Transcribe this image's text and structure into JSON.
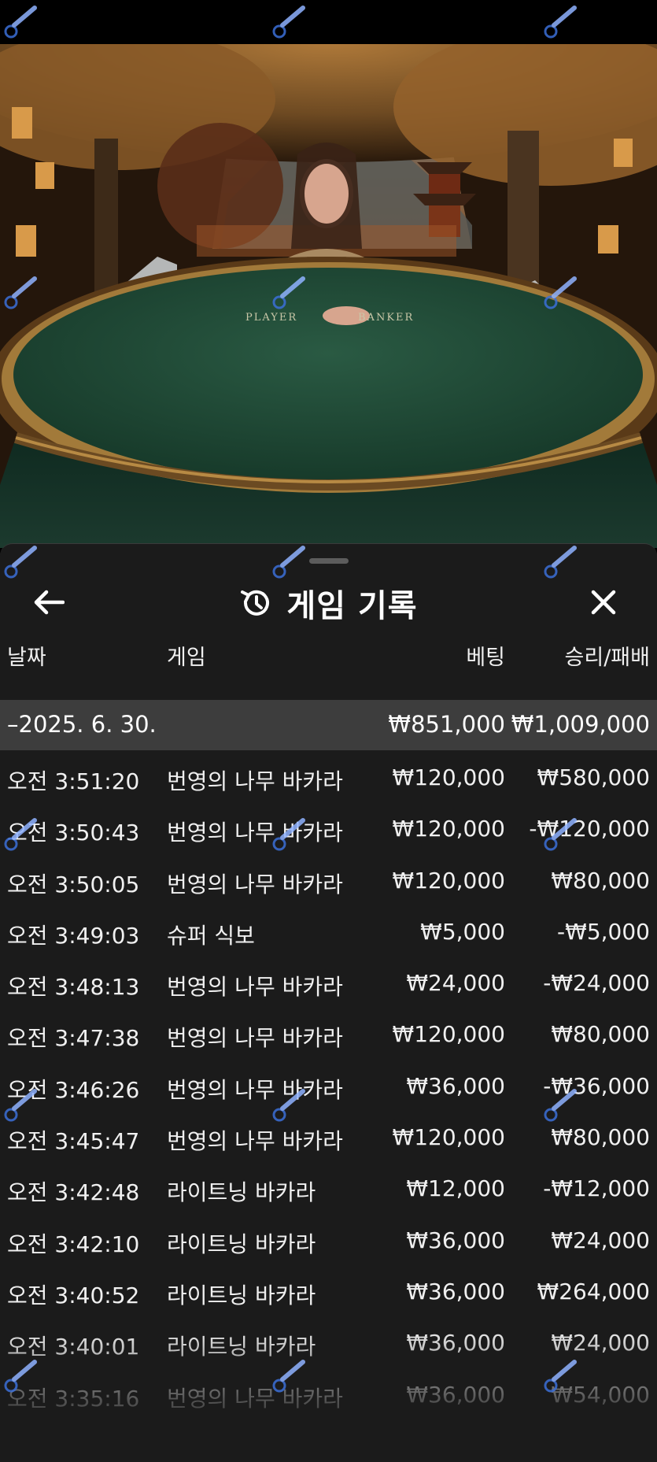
{
  "video": {
    "table_labels": {
      "player": "PLAYER",
      "banker": "BANKER"
    }
  },
  "header": {
    "title": "게임 기록",
    "back_icon": "arrow-left-icon",
    "history_icon": "history-clock-icon",
    "close_icon": "close-icon"
  },
  "columns": {
    "date": "날짜",
    "game": "게임",
    "bet": "베팅",
    "win_loss": "승리/패배"
  },
  "summary": {
    "date": "–2025. 6. 30.",
    "bet_total": "₩851,000",
    "win_loss_total": "₩1,009,000"
  },
  "rows": [
    {
      "time": "오전 3:51:20",
      "game": "번영의 나무 바카라",
      "bet": "₩120,000",
      "win_loss": "₩580,000"
    },
    {
      "time": "오전 3:50:43",
      "game": "번영의 나무 바카라",
      "bet": "₩120,000",
      "win_loss": "-₩120,000"
    },
    {
      "time": "오전 3:50:05",
      "game": "번영의 나무 바카라",
      "bet": "₩120,000",
      "win_loss": "₩80,000"
    },
    {
      "time": "오전 3:49:03",
      "game": "슈퍼 식보",
      "bet": "₩5,000",
      "win_loss": "-₩5,000"
    },
    {
      "time": "오전 3:48:13",
      "game": "번영의 나무 바카라",
      "bet": "₩24,000",
      "win_loss": "-₩24,000"
    },
    {
      "time": "오전 3:47:38",
      "game": "번영의 나무 바카라",
      "bet": "₩120,000",
      "win_loss": "₩80,000"
    },
    {
      "time": "오전 3:46:26",
      "game": "번영의 나무 바카라",
      "bet": "₩36,000",
      "win_loss": "-₩36,000"
    },
    {
      "time": "오전 3:45:47",
      "game": "번영의 나무 바카라",
      "bet": "₩120,000",
      "win_loss": "₩80,000"
    },
    {
      "time": "오전 3:42:48",
      "game": "라이트닝 바카라",
      "bet": "₩12,000",
      "win_loss": "-₩12,000"
    },
    {
      "time": "오전 3:42:10",
      "game": "라이트닝 바카라",
      "bet": "₩36,000",
      "win_loss": "₩24,000"
    },
    {
      "time": "오전 3:40:52",
      "game": "라이트닝 바카라",
      "bet": "₩36,000",
      "win_loss": "₩264,000"
    },
    {
      "time": "오전 3:40:01",
      "game": "라이트닝 바카라",
      "bet": "₩36,000",
      "win_loss": "₩24,000"
    },
    {
      "time": "오전 3:35:16",
      "game": "번영의 나무 바카라",
      "bet": "₩36,000",
      "win_loss": "₩54,000"
    }
  ],
  "colors": {
    "panel_bg": "#1b1b1b",
    "summary_row_bg": "#3d3d3d",
    "table_felt": "#1f4a35",
    "text": "#f0f0f0"
  }
}
